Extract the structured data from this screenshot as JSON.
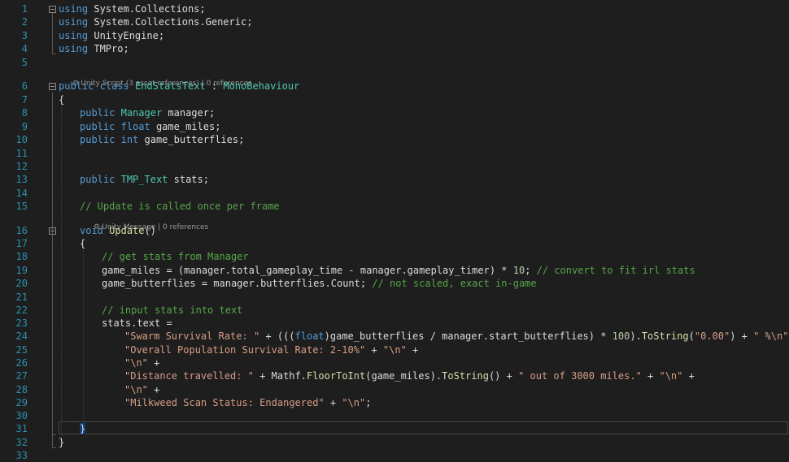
{
  "line_numbers": [
    "1",
    "2",
    "3",
    "4",
    "5",
    "6",
    "7",
    "8",
    "9",
    "10",
    "11",
    "12",
    "13",
    "14",
    "15",
    "16",
    "17",
    "18",
    "19",
    "20",
    "21",
    "22",
    "23",
    "24",
    "25",
    "26",
    "27",
    "28",
    "29",
    "30",
    "31",
    "32",
    "33"
  ],
  "fold_symbol": "−",
  "code_lens": {
    "class_info": "Unity Script (3 asset references) | 0 references",
    "method_info": "Unity Message | 0 references",
    "icon_glyph": "⚙"
  },
  "lines": [
    {
      "i": 0,
      "indent": 0,
      "tokens": [
        {
          "t": "using",
          "c": "kw"
        },
        {
          "t": " System.Collections;",
          "c": "pl"
        }
      ]
    },
    {
      "i": 1,
      "indent": 0,
      "tokens": [
        {
          "t": "using",
          "c": "kw"
        },
        {
          "t": " System.Collections.Generic;",
          "c": "pl"
        }
      ]
    },
    {
      "i": 2,
      "indent": 0,
      "tokens": [
        {
          "t": "using",
          "c": "kw"
        },
        {
          "t": " UnityEngine;",
          "c": "pl"
        }
      ]
    },
    {
      "i": 3,
      "indent": 0,
      "tokens": [
        {
          "t": "using",
          "c": "kw"
        },
        {
          "t": " TMPro;",
          "c": "pl"
        }
      ]
    },
    {
      "i": 4,
      "indent": 0,
      "tokens": []
    },
    {
      "i": 5,
      "indent": 0,
      "tokens": [
        {
          "t": "public",
          "c": "kw"
        },
        {
          "t": " ",
          "c": "pl"
        },
        {
          "t": "class",
          "c": "kw"
        },
        {
          "t": " ",
          "c": "pl"
        },
        {
          "t": "EndStatsText",
          "c": "ty"
        },
        {
          "t": " : ",
          "c": "pl"
        },
        {
          "t": "MonoBehaviour",
          "c": "ty"
        }
      ]
    },
    {
      "i": 6,
      "indent": 0,
      "tokens": [
        {
          "t": "{",
          "c": "pl"
        }
      ]
    },
    {
      "i": 7,
      "indent": 1,
      "tokens": [
        {
          "t": "public",
          "c": "kw"
        },
        {
          "t": " ",
          "c": "pl"
        },
        {
          "t": "Manager",
          "c": "ty"
        },
        {
          "t": " manager;",
          "c": "pl"
        }
      ]
    },
    {
      "i": 8,
      "indent": 1,
      "tokens": [
        {
          "t": "public",
          "c": "kw"
        },
        {
          "t": " ",
          "c": "pl"
        },
        {
          "t": "float",
          "c": "kw"
        },
        {
          "t": " game_miles;",
          "c": "pl"
        }
      ]
    },
    {
      "i": 9,
      "indent": 1,
      "tokens": [
        {
          "t": "public",
          "c": "kw"
        },
        {
          "t": " ",
          "c": "pl"
        },
        {
          "t": "int",
          "c": "kw"
        },
        {
          "t": " game_butterflies;",
          "c": "pl"
        }
      ]
    },
    {
      "i": 10,
      "indent": 0,
      "tokens": []
    },
    {
      "i": 11,
      "indent": 0,
      "tokens": []
    },
    {
      "i": 12,
      "indent": 1,
      "tokens": [
        {
          "t": "public",
          "c": "kw"
        },
        {
          "t": " ",
          "c": "pl"
        },
        {
          "t": "TMP_Text",
          "c": "ty"
        },
        {
          "t": " stats;",
          "c": "pl"
        }
      ]
    },
    {
      "i": 13,
      "indent": 0,
      "tokens": []
    },
    {
      "i": 14,
      "indent": 1,
      "tokens": [
        {
          "t": "// Update is called once per frame",
          "c": "cm"
        }
      ]
    },
    {
      "i": 15,
      "indent": 1,
      "tokens": [
        {
          "t": "void",
          "c": "kw"
        },
        {
          "t": " ",
          "c": "pl"
        },
        {
          "t": "Update",
          "c": "fn"
        },
        {
          "t": "()",
          "c": "pl"
        }
      ]
    },
    {
      "i": 16,
      "indent": 1,
      "tokens": [
        {
          "t": "{",
          "c": "pl"
        }
      ]
    },
    {
      "i": 17,
      "indent": 2,
      "tokens": [
        {
          "t": "// get stats from Manager",
          "c": "cm"
        }
      ]
    },
    {
      "i": 18,
      "indent": 2,
      "tokens": [
        {
          "t": "game_miles = (manager.total_gameplay_time - manager.gameplay_timer) * ",
          "c": "pl"
        },
        {
          "t": "10",
          "c": "num"
        },
        {
          "t": "; ",
          "c": "pl"
        },
        {
          "t": "// convert to fit irl stats",
          "c": "cm"
        }
      ]
    },
    {
      "i": 19,
      "indent": 2,
      "tokens": [
        {
          "t": "game_butterflies = manager.butterflies.Count; ",
          "c": "pl"
        },
        {
          "t": "// not scaled, exact in-game",
          "c": "cm"
        }
      ]
    },
    {
      "i": 20,
      "indent": 0,
      "tokens": []
    },
    {
      "i": 21,
      "indent": 2,
      "tokens": [
        {
          "t": "// input stats into text",
          "c": "cm"
        }
      ]
    },
    {
      "i": 22,
      "indent": 2,
      "tokens": [
        {
          "t": "stats.text =",
          "c": "pl"
        }
      ]
    },
    {
      "i": 23,
      "indent": 3,
      "tokens": [
        {
          "t": "\"Swarm Survival Rate: \"",
          "c": "str"
        },
        {
          "t": " + (((",
          "c": "pl"
        },
        {
          "t": "float",
          "c": "kw"
        },
        {
          "t": ")game_butterflies / manager.start_butterflies) * ",
          "c": "pl"
        },
        {
          "t": "100",
          "c": "num"
        },
        {
          "t": ").",
          "c": "pl"
        },
        {
          "t": "ToString",
          "c": "fn"
        },
        {
          "t": "(",
          "c": "pl"
        },
        {
          "t": "\"0.00\"",
          "c": "str"
        },
        {
          "t": ") + ",
          "c": "pl"
        },
        {
          "t": "\" %\\n\"",
          "c": "str"
        },
        {
          "t": " +",
          "c": "pl"
        }
      ]
    },
    {
      "i": 24,
      "indent": 3,
      "tokens": [
        {
          "t": "\"Overall Population Survival Rate: 2-10%\"",
          "c": "str"
        },
        {
          "t": " + ",
          "c": "pl"
        },
        {
          "t": "\"\\n\"",
          "c": "str"
        },
        {
          "t": " +",
          "c": "pl"
        }
      ]
    },
    {
      "i": 25,
      "indent": 3,
      "tokens": [
        {
          "t": "\"\\n\"",
          "c": "str"
        },
        {
          "t": " +",
          "c": "pl"
        }
      ]
    },
    {
      "i": 26,
      "indent": 3,
      "tokens": [
        {
          "t": "\"Distance travelled: \"",
          "c": "str"
        },
        {
          "t": " + Mathf.",
          "c": "pl"
        },
        {
          "t": "FloorToInt",
          "c": "fn"
        },
        {
          "t": "(game_miles).",
          "c": "pl"
        },
        {
          "t": "ToString",
          "c": "fn"
        },
        {
          "t": "() + ",
          "c": "pl"
        },
        {
          "t": "\" out of 3000 miles.\"",
          "c": "str"
        },
        {
          "t": " + ",
          "c": "pl"
        },
        {
          "t": "\"\\n\"",
          "c": "str"
        },
        {
          "t": " +",
          "c": "pl"
        }
      ]
    },
    {
      "i": 27,
      "indent": 3,
      "tokens": [
        {
          "t": "\"\\n\"",
          "c": "str"
        },
        {
          "t": " +",
          "c": "pl"
        }
      ]
    },
    {
      "i": 28,
      "indent": 3,
      "tokens": [
        {
          "t": "\"Milkweed Scan Status: Endangered\"",
          "c": "str"
        },
        {
          "t": " + ",
          "c": "pl"
        },
        {
          "t": "\"\\n\"",
          "c": "str"
        },
        {
          "t": ";",
          "c": "pl"
        }
      ]
    },
    {
      "i": 29,
      "indent": 0,
      "tokens": []
    },
    {
      "i": 30,
      "indent": 1,
      "tokens": [
        {
          "t": "}",
          "c": "bm"
        }
      ]
    },
    {
      "i": 31,
      "indent": 0,
      "tokens": [
        {
          "t": "}",
          "c": "pl"
        }
      ]
    },
    {
      "i": 32,
      "indent": 0,
      "tokens": []
    }
  ]
}
